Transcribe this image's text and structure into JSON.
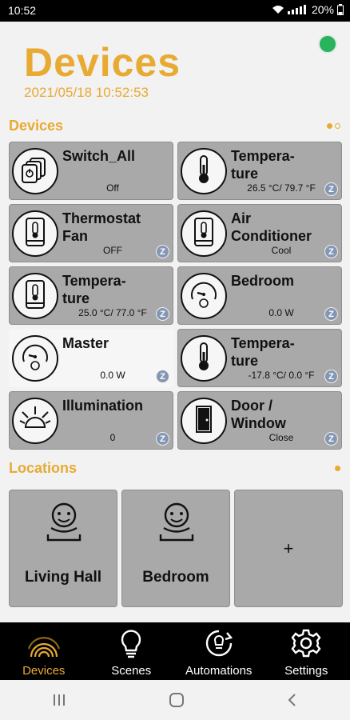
{
  "status_bar": {
    "time": "10:52",
    "battery": "20%"
  },
  "header": {
    "title": "Devices",
    "datetime": "2021/05/18 10:52:53",
    "status_color": "#27b45c"
  },
  "devices_section": {
    "title": "Devices"
  },
  "devices": [
    {
      "name": "Switch_All",
      "value": "Off",
      "icon": "switch-group-icon",
      "badge": false
    },
    {
      "name": "Tempera-\nture",
      "value": "26.5 °C/ 79.7 °F",
      "icon": "thermometer-icon",
      "badge": true,
      "badge_text": "Z"
    },
    {
      "name": "Thermostat\nFan",
      "value": "OFF",
      "icon": "thermostat-icon",
      "badge": true,
      "badge_text": "Z"
    },
    {
      "name": "Air\nConditioner",
      "value": "Cool",
      "icon": "thermostat-icon",
      "badge": true,
      "badge_text": "Z"
    },
    {
      "name": "Tempera-\nture",
      "value": "25.0 °C/ 77.0 °F",
      "icon": "thermostat-icon",
      "badge": true,
      "badge_text": "Z"
    },
    {
      "name": "Bedroom",
      "value": "0.0 W",
      "icon": "power-meter-icon",
      "badge": true,
      "badge_text": "Z"
    },
    {
      "name": "Master",
      "value": "0.0 W",
      "icon": "power-meter-icon",
      "badge": true,
      "badge_text": "Z",
      "active": true
    },
    {
      "name": "Tempera-\nture",
      "value": "-17.8 °C/ 0.0 °F",
      "icon": "thermometer-icon",
      "badge": true,
      "badge_text": "Z"
    },
    {
      "name": "Illumination",
      "value": "0",
      "icon": "light-sensor-icon",
      "badge": true,
      "badge_text": "Z"
    },
    {
      "name": "Door /\nWindow",
      "value": "Close",
      "icon": "door-icon",
      "badge": true,
      "badge_text": "Z"
    }
  ],
  "locations_section": {
    "title": "Locations"
  },
  "locations": [
    {
      "name": "Living Hall",
      "icon": "location-face-icon"
    },
    {
      "name": "Bedroom",
      "icon": "location-face-icon"
    }
  ],
  "add_location": {
    "label": "+"
  },
  "bottom_nav": [
    {
      "label": "Devices",
      "icon": "devices-icon",
      "selected": true
    },
    {
      "label": "Scenes",
      "icon": "lightbulb-icon",
      "selected": false
    },
    {
      "label": "Automations",
      "icon": "automation-icon",
      "selected": false
    },
    {
      "label": "Settings",
      "icon": "gear-icon",
      "selected": false
    }
  ],
  "colors": {
    "accent": "#e8aa33",
    "card": "#a9a9a9",
    "card_active": "#f6f6f6",
    "zbadge": "#8496b4"
  }
}
